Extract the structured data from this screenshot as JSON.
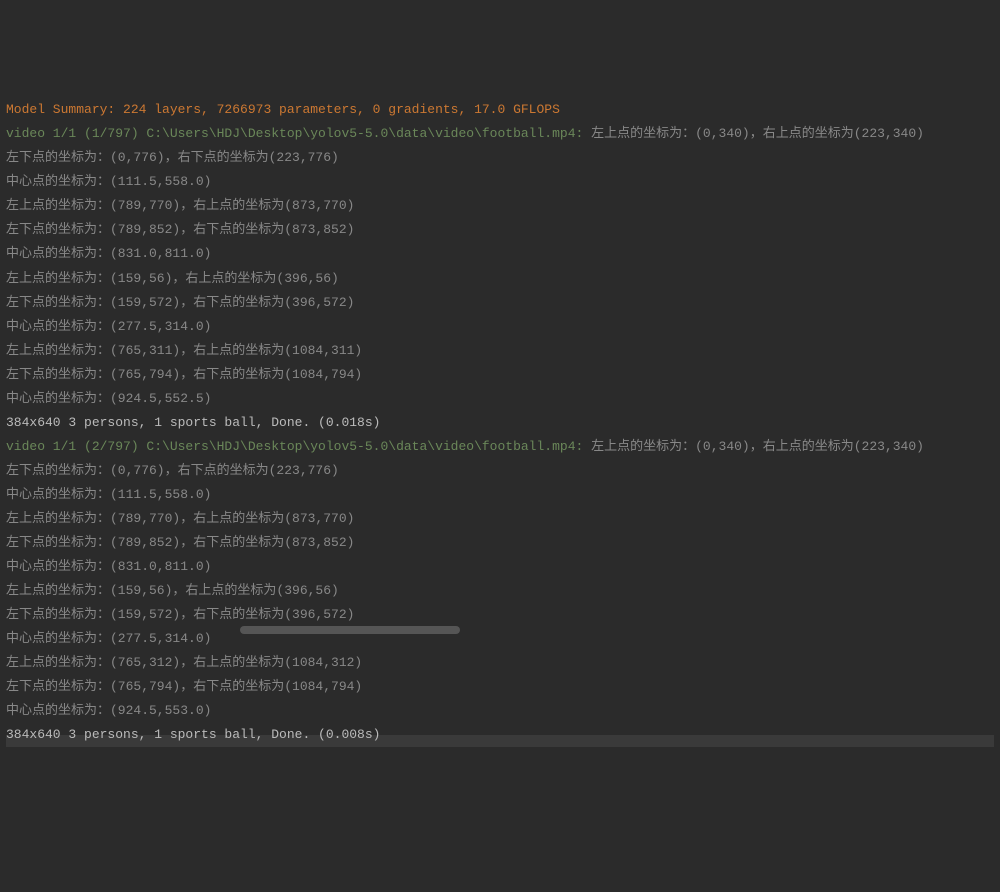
{
  "summary": "Model Summary: 224 layers, 7266973 parameters, 0 gradients, 17.0 GFLOPS",
  "frames": [
    {
      "header_path": "video 1/1 (1/797) C:\\Users\\HDJ\\Desktop\\yolov5-5.0\\data\\video\\football.mp4: ",
      "header_tail": "左上点的坐标为：(0,340)，右上点的坐标为(223,340)",
      "lines": [
        "左下点的坐标为：(0,776)，右下点的坐标为(223,776)",
        "中心点的坐标为：(111.5,558.0)",
        "左上点的坐标为：(789,770)，右上点的坐标为(873,770)",
        "左下点的坐标为：(789,852)，右下点的坐标为(873,852)",
        "中心点的坐标为：(831.0,811.0)",
        "左上点的坐标为：(159,56)，右上点的坐标为(396,56)",
        "左下点的坐标为：(159,572)，右下点的坐标为(396,572)",
        "中心点的坐标为：(277.5,314.0)",
        "左上点的坐标为：(765,311)，右上点的坐标为(1084,311)",
        "左下点的坐标为：(765,794)，右下点的坐标为(1084,794)",
        "中心点的坐标为：(924.5,552.5)",
        "384x640 3 persons, 1 sports ball, Done. (0.018s)"
      ]
    },
    {
      "header_path": "video 1/1 (2/797) C:\\Users\\HDJ\\Desktop\\yolov5-5.0\\data\\video\\football.mp4: ",
      "header_tail": "左上点的坐标为：(0,340)，右上点的坐标为(223,340)",
      "lines": [
        "左下点的坐标为：(0,776)，右下点的坐标为(223,776)",
        "中心点的坐标为：(111.5,558.0)",
        "左上点的坐标为：(789,770)，右上点的坐标为(873,770)",
        "左下点的坐标为：(789,852)，右下点的坐标为(873,852)",
        "中心点的坐标为：(831.0,811.0)",
        "左上点的坐标为：(159,56)，右上点的坐标为(396,56)",
        "左下点的坐标为：(159,572)，右下点的坐标为(396,572)",
        "中心点的坐标为：(277.5,314.0)",
        "左上点的坐标为：(765,312)，右上点的坐标为(1084,312)",
        "左下点的坐标为：(765,794)，右下点的坐标为(1084,794)",
        "中心点的坐标为：(924.5,553.0)",
        "384x640 3 persons, 1 sports ball, Done. (0.008s)"
      ]
    }
  ]
}
